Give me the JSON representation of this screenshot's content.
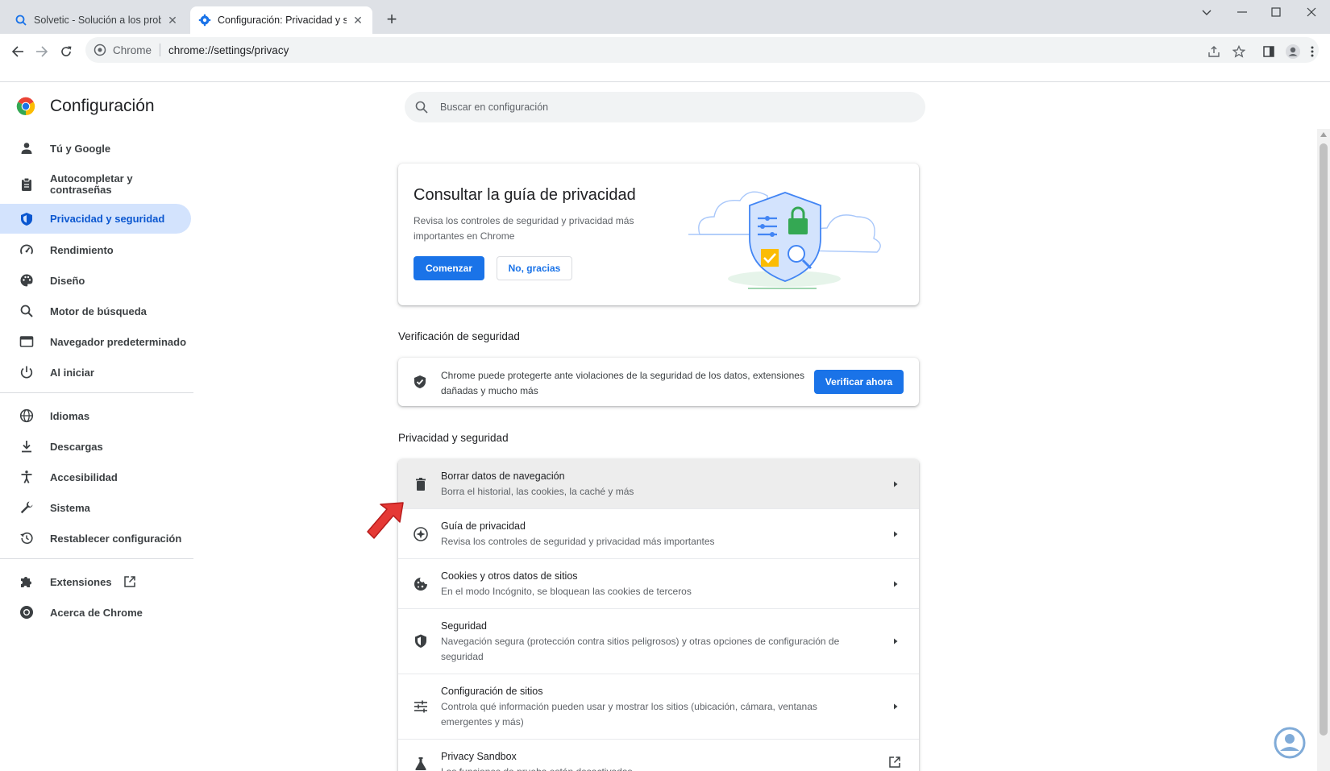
{
  "browser": {
    "tabs": [
      {
        "title": "Solvetic - Solución a los problemas",
        "active": false
      },
      {
        "title": "Configuración: Privacidad y seguridad",
        "active": true
      }
    ],
    "omnibox": {
      "chip": "Chrome",
      "url": "chrome://settings/privacy"
    }
  },
  "settings": {
    "title": "Configuración",
    "search_placeholder": "Buscar en configuración",
    "sidebar": {
      "items": [
        {
          "label": "Tú y Google",
          "icon": "person-icon"
        },
        {
          "label": "Autocompletar y contraseñas",
          "icon": "clipboard-icon"
        },
        {
          "label": "Privacidad y seguridad",
          "icon": "shield-icon",
          "active": true
        },
        {
          "label": "Rendimiento",
          "icon": "speedometer-icon"
        },
        {
          "label": "Diseño",
          "icon": "palette-icon"
        },
        {
          "label": "Motor de búsqueda",
          "icon": "search-icon"
        },
        {
          "label": "Navegador predeterminado",
          "icon": "browser-icon"
        },
        {
          "label": "Al iniciar",
          "icon": "power-icon"
        },
        {
          "label": "Idiomas",
          "icon": "globe-icon"
        },
        {
          "label": "Descargas",
          "icon": "download-icon"
        },
        {
          "label": "Accesibilidad",
          "icon": "accessibility-icon"
        },
        {
          "label": "Sistema",
          "icon": "wrench-icon"
        },
        {
          "label": "Restablecer configuración",
          "icon": "restore-icon"
        },
        {
          "label": "Extensiones",
          "icon": "puzzle-icon"
        },
        {
          "label": "Acerca de Chrome",
          "icon": "chrome-icon"
        }
      ]
    },
    "privacy_guide": {
      "title": "Consultar la guía de privacidad",
      "description": "Revisa los controles de seguridad y privacidad más importantes en Chrome",
      "start_button": "Comenzar",
      "dismiss_button": "No, gracias"
    },
    "safety_check": {
      "heading": "Verificación de seguridad",
      "text": "Chrome puede protegerte ante violaciones de la seguridad de los datos, extensiones dañadas y mucho más",
      "button": "Verificar ahora"
    },
    "privacy_section": {
      "heading": "Privacidad y seguridad",
      "rows": [
        {
          "title": "Borrar datos de navegación",
          "subtitle": "Borra el historial, las cookies, la caché y más",
          "icon": "trash-icon"
        },
        {
          "title": "Guía de privacidad",
          "subtitle": "Revisa los controles de seguridad y privacidad más importantes",
          "icon": "compass-icon"
        },
        {
          "title": "Cookies y otros datos de sitios",
          "subtitle": "En el modo Incógnito, se bloquean las cookies de terceros",
          "icon": "cookie-icon"
        },
        {
          "title": "Seguridad",
          "subtitle": "Navegación segura (protección contra sitios peligrosos) y otras opciones de configuración de seguridad",
          "icon": "security-shield-icon"
        },
        {
          "title": "Configuración de sitios",
          "subtitle": "Controla qué información pueden usar y mostrar los sitios (ubicación, cámara, ventanas emergentes y más)",
          "icon": "tune-icon"
        },
        {
          "title": "Privacy Sandbox",
          "subtitle": "Las funciones de prueba están desactivadas",
          "icon": "flask-icon"
        }
      ]
    }
  },
  "colors": {
    "accent": "#1a73e8",
    "active_nav_bg": "#d3e3fd",
    "active_nav_text": "#0b57d0",
    "annotation_arrow": "#e53935"
  }
}
